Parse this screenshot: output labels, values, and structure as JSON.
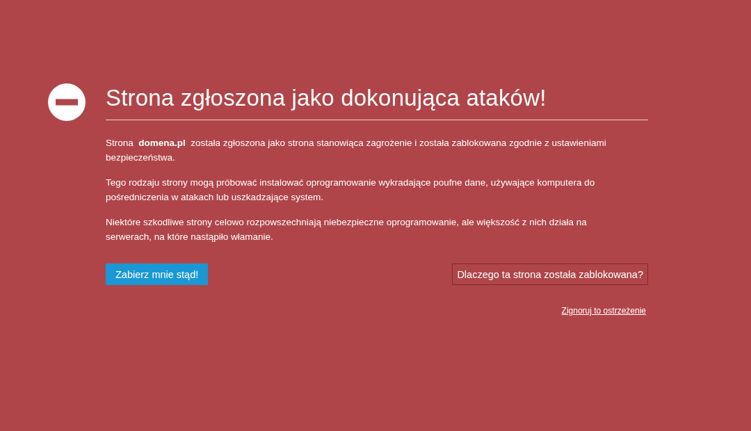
{
  "title": "Strona zgłoszona jako dokonująca ataków!",
  "paragraphs": [
    "Strona  **domena.pl**  została zgłoszona jako strona stanowiąca zagrożenie i została zablokowana zgodnie z ustawieniami bezpieczeństwa.",
    "Tego rodzaju strony mogą próbować instalować oprogramowanie wykradające poufne dane, używające komputera do pośredniczenia w atakach lub uszkadzające system.",
    "Niektóre szkodliwe strony celowo rozpowszechniają niebezpieczne oprogramowanie, ale większość z nich działa na serwerach, na które nastąpiło włamanie."
  ],
  "primary_button": "Zabierz mnie stąd!",
  "secondary_button": "Dlaczego ta strona została zablokowana?",
  "ignore_link": "Zignoruj to ostrzeżenie"
}
